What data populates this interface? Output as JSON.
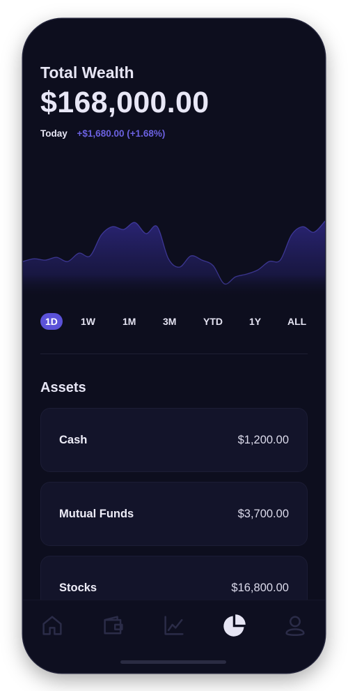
{
  "header": {
    "title": "Total Wealth",
    "amount": "$168,000.00",
    "today_label": "Today",
    "today_change": "+$1,680.00 (+1.68%)"
  },
  "chart_data": {
    "type": "area",
    "x": [
      0,
      1,
      2,
      3,
      4,
      5,
      6,
      7,
      8,
      9,
      10,
      11,
      12,
      13,
      14,
      15,
      16,
      17,
      18,
      19,
      20,
      21,
      22,
      23,
      24,
      25,
      26,
      27
    ],
    "series": [
      {
        "values": [
          17,
          19,
          18,
          20,
          17,
          23,
          21,
          36,
          42,
          40,
          45,
          37,
          42,
          19,
          13,
          21,
          18,
          14,
          1,
          6,
          8,
          11,
          17,
          18,
          36,
          42,
          38,
          46
        ]
      }
    ],
    "ylim": [
      0,
      100
    ],
    "grid": false,
    "color": "#5b52d8"
  },
  "ranges": {
    "items": [
      "1D",
      "1W",
      "1M",
      "3M",
      "YTD",
      "1Y",
      "ALL"
    ],
    "active": "1D"
  },
  "assets": {
    "title": "Assets",
    "items": [
      {
        "name": "Cash",
        "value": "$1,200.00"
      },
      {
        "name": "Mutual Funds",
        "value": "$3,700.00"
      },
      {
        "name": "Stocks",
        "value": "$16,800.00"
      }
    ]
  },
  "tabbar": {
    "items": [
      "home-icon",
      "wallet-icon",
      "chart-icon",
      "pie-chart-icon",
      "profile-icon"
    ],
    "active_index": 3,
    "active_color": "#e6e5f4",
    "inactive_color": "#2b2c48"
  }
}
